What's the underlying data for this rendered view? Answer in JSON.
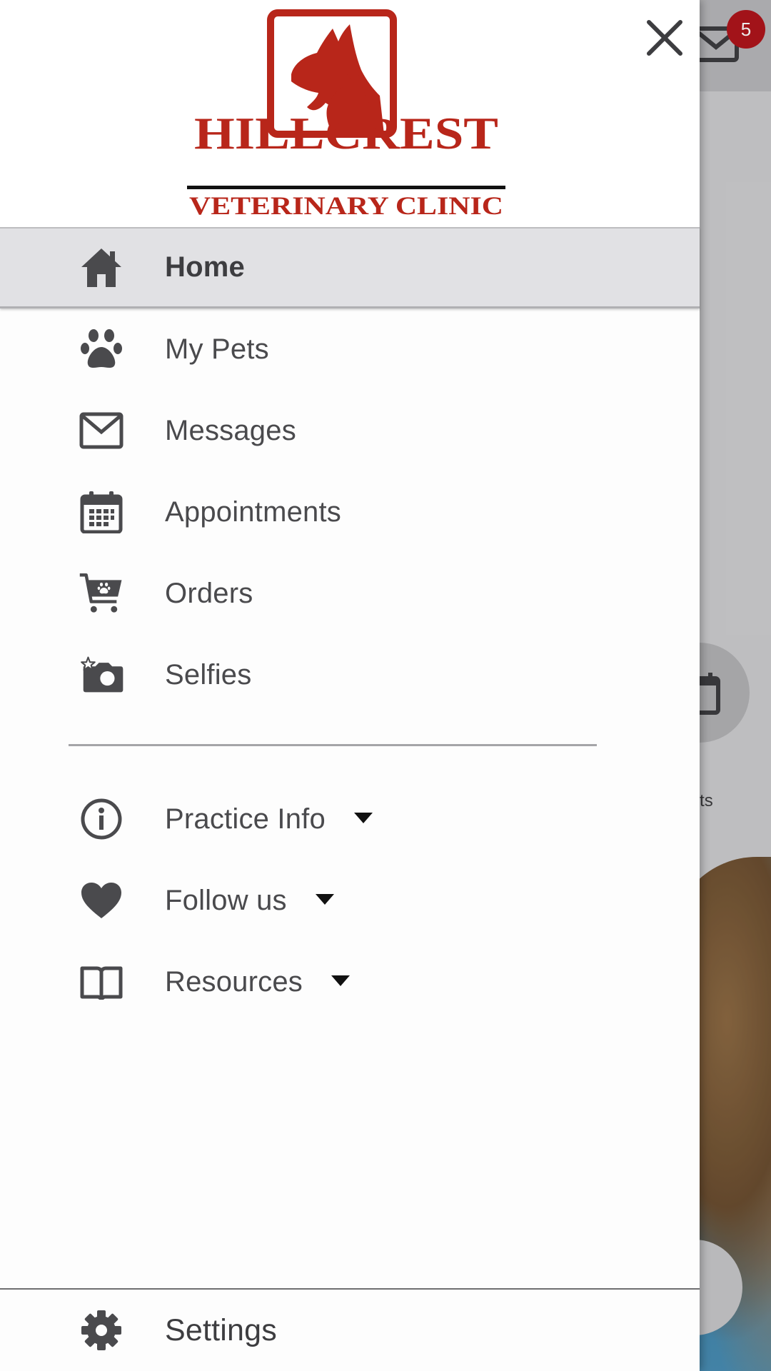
{
  "background_app": {
    "mail_badge_count": "5",
    "partial_label": "nents"
  },
  "drawer": {
    "logo": {
      "name": "HILLCREST",
      "subtitle": "VETERINARY CLINIC",
      "brand_color": "#b8261a"
    },
    "close_icon": "close-icon",
    "items": [
      {
        "label": "Home",
        "icon": "home-icon",
        "active": true
      },
      {
        "label": "My Pets",
        "icon": "paw-icon",
        "active": false
      },
      {
        "label": "Messages",
        "icon": "envelope-icon",
        "active": false
      },
      {
        "label": "Appointments",
        "icon": "calendar-icon",
        "active": false
      },
      {
        "label": "Orders",
        "icon": "cart-icon",
        "active": false
      },
      {
        "label": "Selfies",
        "icon": "camera-icon",
        "active": false
      }
    ],
    "expandable_items": [
      {
        "label": "Practice Info",
        "icon": "info-icon",
        "expanded": false
      },
      {
        "label": "Follow us",
        "icon": "heart-icon",
        "expanded": false
      },
      {
        "label": "Resources",
        "icon": "book-icon",
        "expanded": false
      }
    ],
    "settings": {
      "label": "Settings",
      "icon": "gear-icon"
    },
    "colors": {
      "active_bg": "#e1e1e4",
      "icon": "#4a4a4d",
      "text": "#4a4a4d"
    }
  }
}
